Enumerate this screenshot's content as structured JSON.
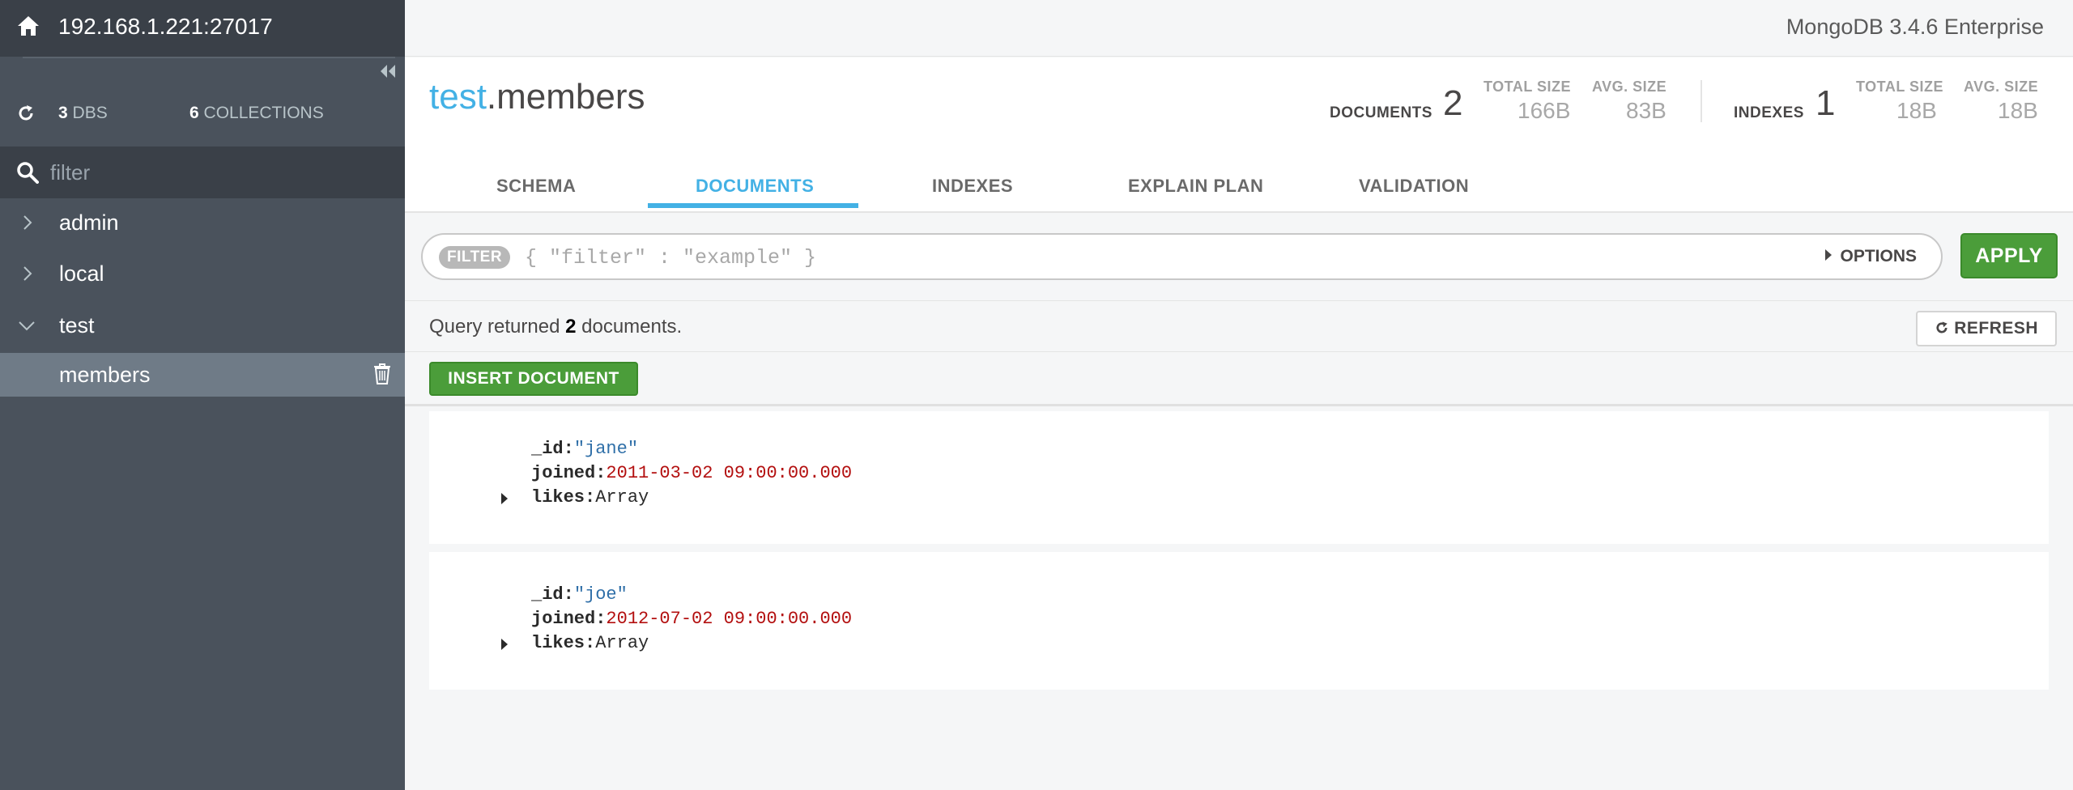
{
  "sidebar": {
    "host": "192.168.1.221:27017",
    "dbs_count": "3",
    "dbs_label": "DBS",
    "collections_count": "6",
    "collections_label": "COLLECTIONS",
    "filter_placeholder": "filter",
    "databases": [
      {
        "name": "admin",
        "expanded": false
      },
      {
        "name": "local",
        "expanded": false
      },
      {
        "name": "test",
        "expanded": true
      }
    ],
    "active_collection": "members"
  },
  "topbar": {
    "version": "MongoDB 3.4.6 Enterprise"
  },
  "header": {
    "ns_db": "test",
    "ns_dot": ".",
    "ns_collection": "members",
    "documents_label": "DOCUMENTS",
    "documents_count": "2",
    "doc_total_size_label": "TOTAL SIZE",
    "doc_total_size": "166B",
    "doc_avg_size_label": "AVG. SIZE",
    "doc_avg_size": "83B",
    "indexes_label": "INDEXES",
    "indexes_count": "1",
    "idx_total_size_label": "TOTAL SIZE",
    "idx_total_size": "18B",
    "idx_avg_size_label": "AVG. SIZE",
    "idx_avg_size": "18B",
    "tabs": [
      "SCHEMA",
      "DOCUMENTS",
      "INDEXES",
      "EXPLAIN PLAN",
      "VALIDATION"
    ],
    "active_tab": "DOCUMENTS"
  },
  "query": {
    "filter_pill": "FILTER",
    "placeholder": "{ \"filter\" : \"example\" }",
    "options_label": "OPTIONS",
    "apply_label": "APPLY"
  },
  "results": {
    "prefix": "Query returned ",
    "count": "2",
    "suffix": " documents.",
    "refresh_label": "REFRESH",
    "insert_label": "INSERT DOCUMENT"
  },
  "documents": [
    {
      "id_key": "_id:",
      "id_val": "\"jane\"",
      "joined_key": "joined:",
      "joined_val": "2011-03-02 09:00:00.000",
      "likes_key": "likes:",
      "likes_val": "Array"
    },
    {
      "id_key": "_id:",
      "id_val": "\"joe\"",
      "joined_key": "joined:",
      "joined_val": "2012-07-02 09:00:00.000",
      "likes_key": "likes:",
      "likes_val": "Array"
    }
  ],
  "colors": {
    "accent": "#43b1e5",
    "green": "#4b9d3a",
    "sidebar_bg": "#4a525c",
    "string": "#2f6fa8",
    "date": "#b30f0f"
  }
}
